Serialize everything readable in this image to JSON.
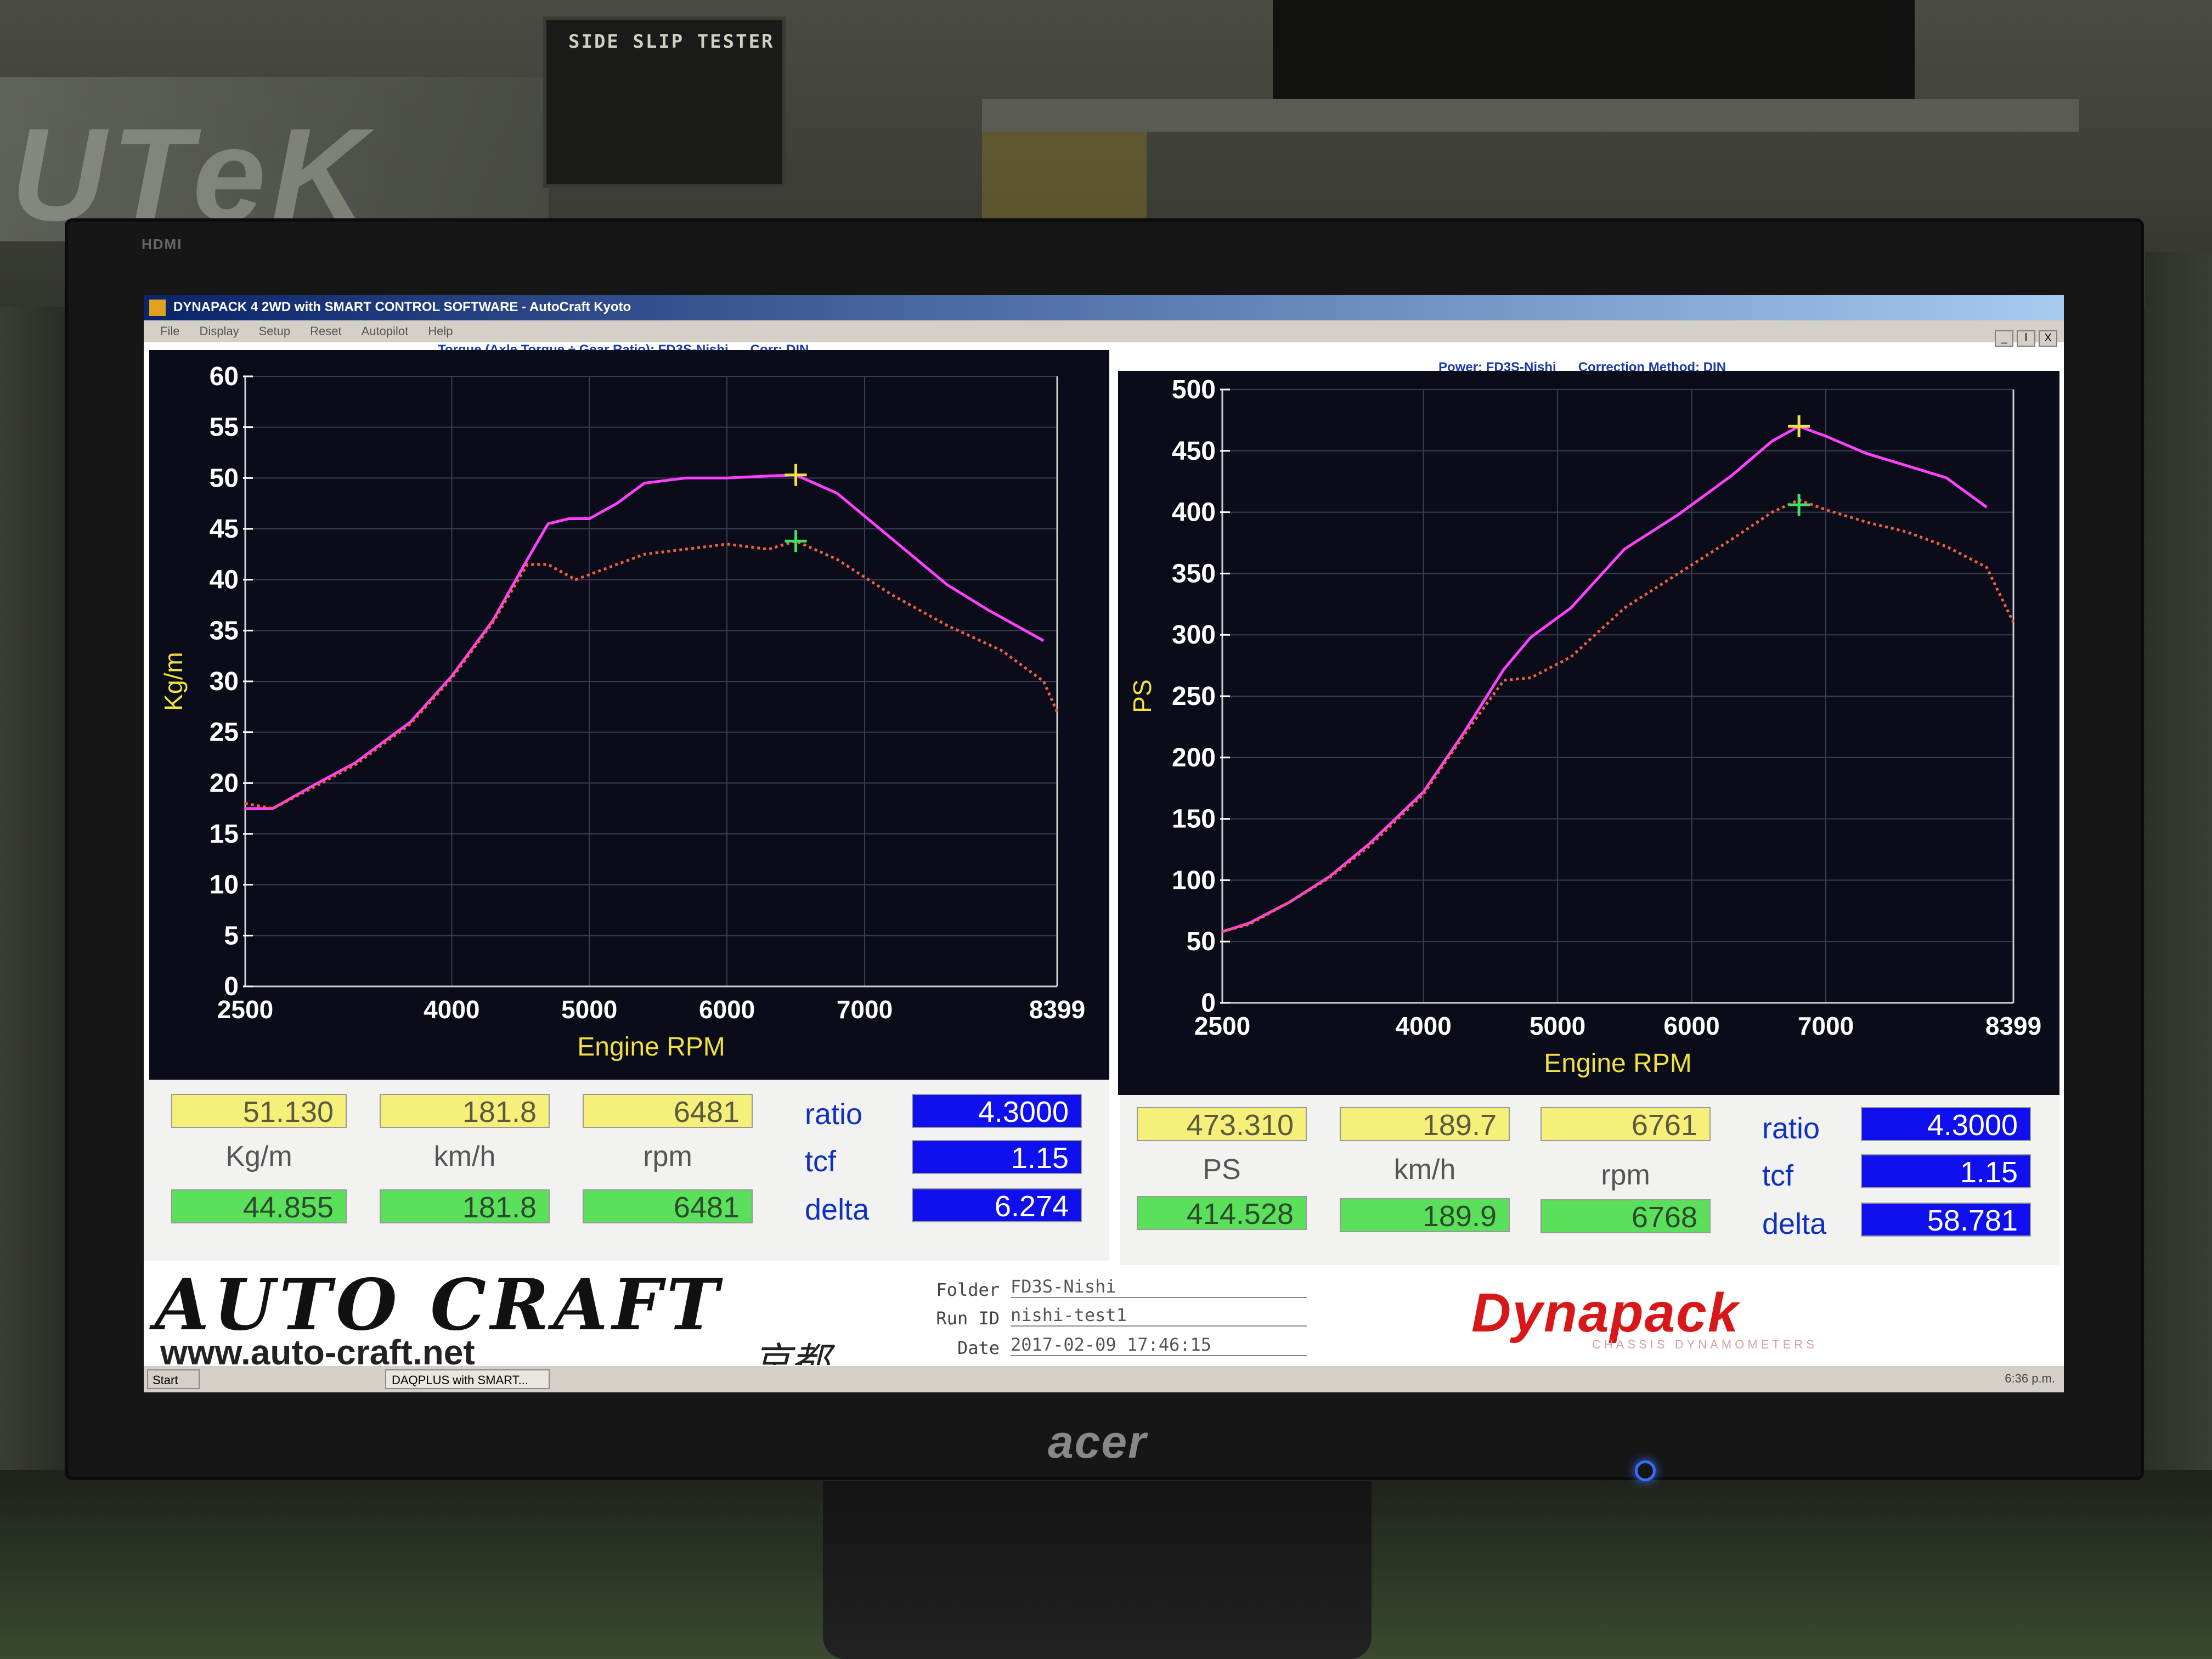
{
  "window": {
    "title": "DYNAPACK 4 2WD with SMART CONTROL SOFTWARE - AutoCraft Kyoto",
    "menu": [
      "File",
      "Display",
      "Setup",
      "Reset",
      "Autopilot",
      "Help"
    ],
    "controls": [
      "_",
      "ǀ",
      "X"
    ]
  },
  "environment": {
    "tester_label": "SIDE SLIP TESTER",
    "wall_letters": "UTeK",
    "monitor_brand": "acer",
    "monitor_port_label": "HDMI"
  },
  "torque_chart_caption": "Torque (Axle Torque ÷ Gear Ratio): FD3S-Nishi      Corr: DIN",
  "power_chart_caption": "Power: FD3S-Nishi      Correction Method: DIN",
  "swatch_colors": [
    "#e83030",
    "#40e060",
    "#2e7ad8",
    "#ff40ff",
    "#40e8f0",
    "#f06040"
  ],
  "chart_data": [
    {
      "type": "line",
      "title": "Torque (Axle Torque ÷ Gear Ratio): FD3S-Nishi",
      "xlabel": "Engine RPM",
      "ylabel": "Kg/m",
      "xlim": [
        2500,
        8399
      ],
      "ylim": [
        0,
        60
      ],
      "x_ticks": [
        2500,
        4000,
        5000,
        6000,
        7000,
        8399
      ],
      "y_ticks": [
        0,
        5,
        10,
        15,
        20,
        25,
        30,
        35,
        40,
        45,
        50,
        55,
        60
      ],
      "grid": true,
      "series": [
        {
          "color": "#ff40ff",
          "style": "solid",
          "x": [
            2500,
            2700,
            3000,
            3300,
            3700,
            4000,
            4300,
            4550,
            4700,
            4850,
            5000,
            5200,
            5400,
            5700,
            6000,
            6300,
            6500,
            6800,
            7200,
            7600,
            7900,
            8300
          ],
          "y": [
            17.5,
            17.5,
            19.8,
            22,
            26,
            30.5,
            36,
            42,
            45.5,
            46,
            46,
            47.5,
            49.5,
            50,
            50,
            50.2,
            50.3,
            48.5,
            44,
            39.5,
            37,
            34
          ]
        },
        {
          "color": "#f06040",
          "style": "dotted",
          "x": [
            2500,
            2700,
            3000,
            3300,
            3700,
            4000,
            4300,
            4550,
            4700,
            4900,
            5100,
            5400,
            5700,
            6000,
            6300,
            6500,
            6800,
            7200,
            7600,
            8000,
            8300,
            8399
          ],
          "y": [
            18,
            17.5,
            19.6,
            21.8,
            25.8,
            30.3,
            35.8,
            41.5,
            41.5,
            40,
            41,
            42.5,
            43,
            43.5,
            43,
            43.8,
            42,
            38.5,
            35.5,
            33,
            30,
            27
          ]
        }
      ],
      "markers": [
        {
          "x": 6500,
          "y": 50.3,
          "color": "#f0e040"
        },
        {
          "x": 6500,
          "y": 43.8,
          "color": "#40e060"
        }
      ]
    },
    {
      "type": "line",
      "title": "Power: FD3S-Nishi",
      "xlabel": "Engine RPM",
      "ylabel": "PS",
      "xlim": [
        2500,
        8399
      ],
      "ylim": [
        0,
        500
      ],
      "x_ticks": [
        2500,
        4000,
        5000,
        6000,
        7000,
        8399
      ],
      "y_ticks": [
        0,
        50,
        100,
        150,
        200,
        250,
        300,
        350,
        400,
        450,
        500
      ],
      "grid": true,
      "series": [
        {
          "color": "#ff40ff",
          "style": "solid",
          "x": [
            2500,
            2700,
            3000,
            3300,
            3600,
            4000,
            4300,
            4600,
            4800,
            5100,
            5500,
            5900,
            6300,
            6600,
            6800,
            7000,
            7300,
            7600,
            7900,
            8200
          ],
          "y": [
            58,
            65,
            82,
            103,
            130,
            172,
            220,
            272,
            298,
            322,
            370,
            398,
            430,
            458,
            470,
            462,
            448,
            438,
            428,
            404
          ]
        },
        {
          "color": "#f06040",
          "style": "dotted",
          "x": [
            2500,
            2700,
            3000,
            3300,
            3600,
            4000,
            4300,
            4600,
            4800,
            5100,
            5500,
            5900,
            6300,
            6600,
            6800,
            7000,
            7300,
            7600,
            7900,
            8200,
            8399
          ],
          "y": [
            58,
            64,
            82,
            102,
            128,
            170,
            218,
            263,
            265,
            282,
            322,
            350,
            378,
            400,
            410,
            402,
            392,
            384,
            372,
            355,
            310
          ]
        }
      ],
      "markers": [
        {
          "x": 6800,
          "y": 470,
          "color": "#f0e040"
        },
        {
          "x": 6800,
          "y": 406,
          "color": "#40e060"
        }
      ]
    }
  ],
  "readouts_left": {
    "top": [
      "51.130",
      "181.8",
      "6481"
    ],
    "units": [
      "Kg/m",
      "km/h",
      "rpm"
    ],
    "bottom": [
      "44.855",
      "181.8",
      "6481"
    ],
    "params": [
      "ratio",
      "tcf",
      "delta"
    ],
    "param_values": [
      "4.3000",
      "1.15",
      "6.274"
    ]
  },
  "readouts_right": {
    "top": [
      "473.310",
      "189.7",
      "6761"
    ],
    "units": [
      "PS",
      "km/h",
      "rpm"
    ],
    "bottom": [
      "414.528",
      "189.9",
      "6768"
    ],
    "params": [
      "ratio",
      "tcf",
      "delta"
    ],
    "param_values": [
      "4.3000",
      "1.15",
      "58.781"
    ]
  },
  "banner": {
    "logo": "AUTO CRAFT",
    "url": "www.auto-craft.net",
    "kanji": "京都",
    "folder_label": "Folder",
    "folder_value": "FD3S-Nishi",
    "runid_label": "Run ID",
    "runid_value": "nishi-test1",
    "date_label": "Date",
    "date_value": "2017-02-09 17:46:15",
    "brand": "Dynapack",
    "brand_sub": "CHASSIS DYNAMOMETERS"
  },
  "taskbar": {
    "start": "Start",
    "task": "DAQPLUS with SMART...",
    "time": "6:36 p.m."
  }
}
